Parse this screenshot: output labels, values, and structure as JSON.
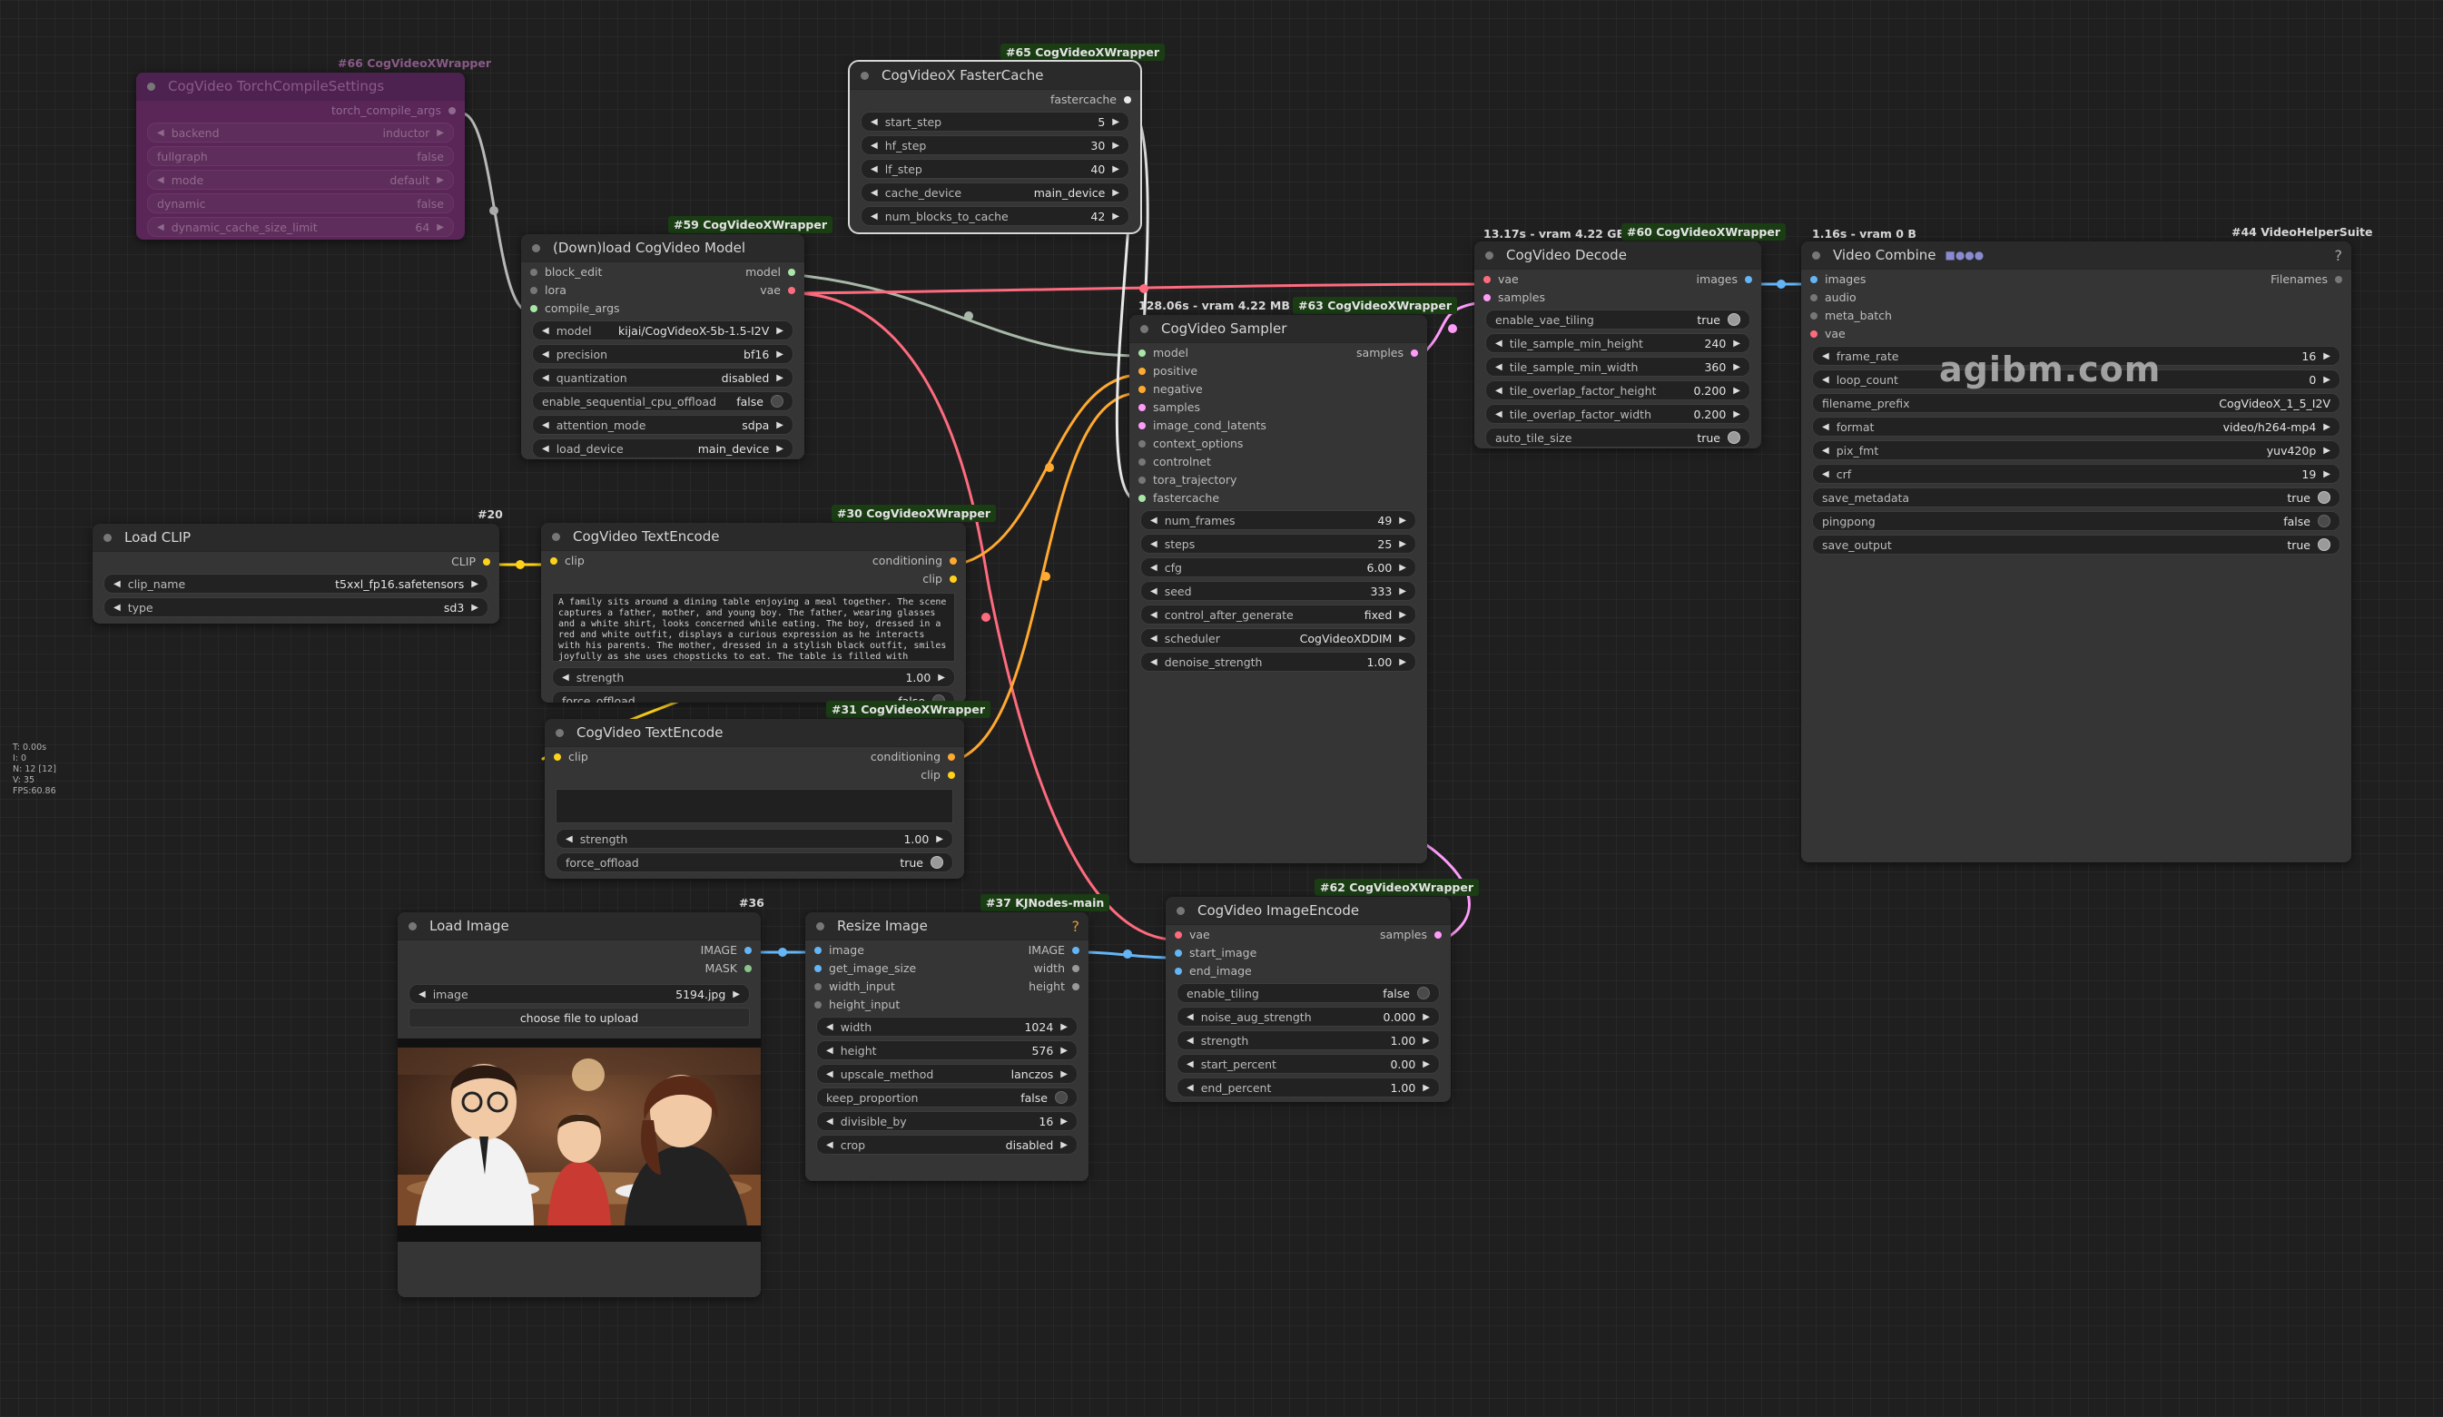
{
  "watermark": "agibm.com",
  "stats": [
    "T: 0.00s",
    "I: 0",
    "N: 12 [12]",
    "V: 35",
    "FPS:60.86"
  ],
  "nodes": {
    "torch": {
      "badge": "#66 CogVideoXWrapper",
      "title": "CogVideo TorchCompileSettings",
      "output": "torch_compile_args",
      "widgets": [
        {
          "label": "backend",
          "value": "inductor"
        },
        {
          "label": "fullgraph",
          "value": "false"
        },
        {
          "label": "mode",
          "value": "default"
        },
        {
          "label": "dynamic",
          "value": "false"
        },
        {
          "label": "dynamic_cache_size_limit",
          "value": "64"
        }
      ]
    },
    "faster": {
      "badge": "#65 CogVideoXWrapper",
      "title": "CogVideoX FasterCache",
      "output": "fastercache",
      "widgets": [
        {
          "label": "start_step",
          "value": "5"
        },
        {
          "label": "hf_step",
          "value": "30"
        },
        {
          "label": "lf_step",
          "value": "40"
        },
        {
          "label": "cache_device",
          "value": "main_device"
        },
        {
          "label": "num_blocks_to_cache",
          "value": "42"
        }
      ]
    },
    "download": {
      "badge": "#59 CogVideoXWrapper",
      "title": "(Down)load CogVideo Model",
      "inputs": [
        "block_edit",
        "lora",
        "compile_args"
      ],
      "outputs": [
        "model",
        "vae"
      ],
      "widgets": [
        {
          "label": "model",
          "value": "kijai/CogVideoX-5b-1.5-I2V"
        },
        {
          "label": "precision",
          "value": "bf16"
        },
        {
          "label": "quantization",
          "value": "disabled"
        },
        {
          "label": "enable_sequential_cpu_offload",
          "value": "false"
        },
        {
          "label": "attention_mode",
          "value": "sdpa"
        },
        {
          "label": "load_device",
          "value": "main_device"
        }
      ]
    },
    "clip": {
      "badge": "#20",
      "title": "Load CLIP",
      "output": "CLIP",
      "widgets": [
        {
          "label": "clip_name",
          "value": "t5xxl_fp16.safetensors"
        },
        {
          "label": "type",
          "value": "sd3"
        }
      ]
    },
    "te1": {
      "badge": "#30 CogVideoXWrapper",
      "title": "CogVideo TextEncode",
      "input": "clip",
      "outputs": [
        "conditioning",
        "clip"
      ],
      "text": "A family sits around a dining table enjoying a meal together. The scene captures a father, mother, and young boy. The father, wearing glasses and a white shirt, looks concerned while eating. The boy, dressed in a red and white outfit, displays a curious expression as he interacts with his parents. The mother, dressed in a stylish black outfit, smiles joyfully as she uses chopsticks to eat. The table is filled with various",
      "widgets": [
        {
          "label": "strength",
          "value": "1.00"
        },
        {
          "label": "force_offload",
          "value": "false"
        }
      ]
    },
    "te2": {
      "badge": "#31 CogVideoXWrapper",
      "title": "CogVideo TextEncode",
      "input": "clip",
      "outputs": [
        "conditioning",
        "clip"
      ],
      "widgets": [
        {
          "label": "strength",
          "value": "1.00"
        },
        {
          "label": "force_offload",
          "value": "true"
        }
      ]
    },
    "sampler": {
      "badge": "#63 CogVideoXWrapper",
      "timing": "128.06s - vram 4.22 MB",
      "title": "CogVideo Sampler",
      "inputs": [
        "model",
        "positive",
        "negative",
        "samples",
        "image_cond_latents",
        "context_options",
        "controlnet",
        "tora_trajectory",
        "fastercache"
      ],
      "output": "samples",
      "widgets": [
        {
          "label": "num_frames",
          "value": "49"
        },
        {
          "label": "steps",
          "value": "25"
        },
        {
          "label": "cfg",
          "value": "6.00"
        },
        {
          "label": "seed",
          "value": "333"
        },
        {
          "label": "control_after_generate",
          "value": "fixed"
        },
        {
          "label": "scheduler",
          "value": "CogVideoXDDIM"
        },
        {
          "label": "denoise_strength",
          "value": "1.00"
        }
      ]
    },
    "decode": {
      "badge": "#60 CogVideoXWrapper",
      "timing": "13.17s - vram 4.22 GB",
      "title": "CogVideo Decode",
      "inputs": [
        "vae",
        "samples"
      ],
      "output": "images",
      "widgets": [
        {
          "label": "enable_vae_tiling",
          "value": "true"
        },
        {
          "label": "tile_sample_min_height",
          "value": "240"
        },
        {
          "label": "tile_sample_min_width",
          "value": "360"
        },
        {
          "label": "tile_overlap_factor_height",
          "value": "0.200"
        },
        {
          "label": "tile_overlap_factor_width",
          "value": "0.200"
        },
        {
          "label": "auto_tile_size",
          "value": "true"
        }
      ]
    },
    "combine": {
      "badge": "#44 VideoHelperSuite",
      "timing": "1.16s - vram 0 B",
      "title": "Video Combine",
      "help": "?",
      "inputs": [
        "images",
        "audio",
        "meta_batch",
        "vae"
      ],
      "output": "Filenames",
      "widgets": [
        {
          "label": "frame_rate",
          "value": "16"
        },
        {
          "label": "loop_count",
          "value": "0"
        },
        {
          "label": "filename_prefix",
          "value": "CogVideoX_1_5_I2V"
        },
        {
          "label": "format",
          "value": "video/h264-mp4"
        },
        {
          "label": "pix_fmt",
          "value": "yuv420p"
        },
        {
          "label": "crf",
          "value": "19"
        },
        {
          "label": "save_metadata",
          "value": "true"
        },
        {
          "label": "pingpong",
          "value": "false"
        },
        {
          "label": "save_output",
          "value": "true"
        }
      ]
    },
    "loadimg": {
      "badge": "#36",
      "title": "Load Image",
      "outputs": [
        "IMAGE",
        "MASK"
      ],
      "image_label": "image",
      "image_value": "5194.jpg",
      "upload_label": "choose file to upload"
    },
    "resize": {
      "badge": "#37 KJNodes-main",
      "title": "Resize Image",
      "help": "?",
      "inputs": [
        "image",
        "get_image_size",
        "width_input",
        "height_input"
      ],
      "outputs": [
        "IMAGE",
        "width",
        "height"
      ],
      "widgets": [
        {
          "label": "width",
          "value": "1024"
        },
        {
          "label": "height",
          "value": "576"
        },
        {
          "label": "upscale_method",
          "value": "lanczos"
        },
        {
          "label": "keep_proportion",
          "value": "false"
        },
        {
          "label": "divisible_by",
          "value": "16"
        },
        {
          "label": "crop",
          "value": "disabled"
        }
      ]
    },
    "imgenc": {
      "badge": "#62 CogVideoXWrapper",
      "title": "CogVideo ImageEncode",
      "inputs": [
        "vae",
        "start_image",
        "end_image"
      ],
      "output": "samples",
      "widgets": [
        {
          "label": "enable_tiling",
          "value": "false"
        },
        {
          "label": "noise_aug_strength",
          "value": "0.000"
        },
        {
          "label": "strength",
          "value": "1.00"
        },
        {
          "label": "start_percent",
          "value": "0.00"
        },
        {
          "label": "end_percent",
          "value": "1.00"
        }
      ]
    }
  }
}
